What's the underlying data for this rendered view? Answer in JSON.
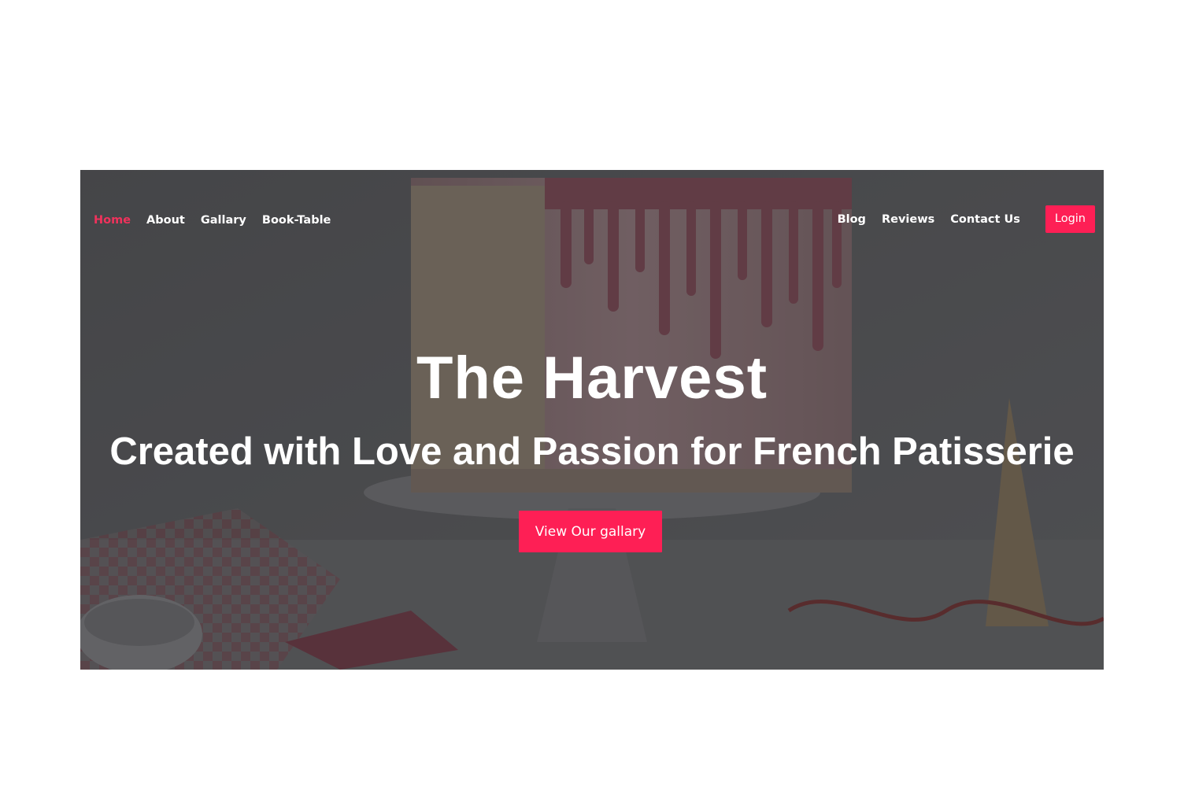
{
  "nav": {
    "left_items": [
      {
        "label": "Home",
        "active": true
      },
      {
        "label": "About",
        "active": false
      },
      {
        "label": "Gallary",
        "active": false
      },
      {
        "label": "Book-Table",
        "active": false
      }
    ],
    "right_items": [
      {
        "label": "Blog"
      },
      {
        "label": "Reviews"
      },
      {
        "label": "Contact Us"
      }
    ],
    "login_label": "Login"
  },
  "hero": {
    "title": "The Harvest",
    "subtitle": "Created with Love and Passion for French Patisserie",
    "cta_label": "View Our gallary",
    "background_image": "cake-with-pink-drip-icing-and-sprinkles"
  },
  "colors": {
    "accent": "#fe1f55",
    "active_link": "#f0325c",
    "overlay": "#3f4043",
    "text": "#ffffff"
  }
}
